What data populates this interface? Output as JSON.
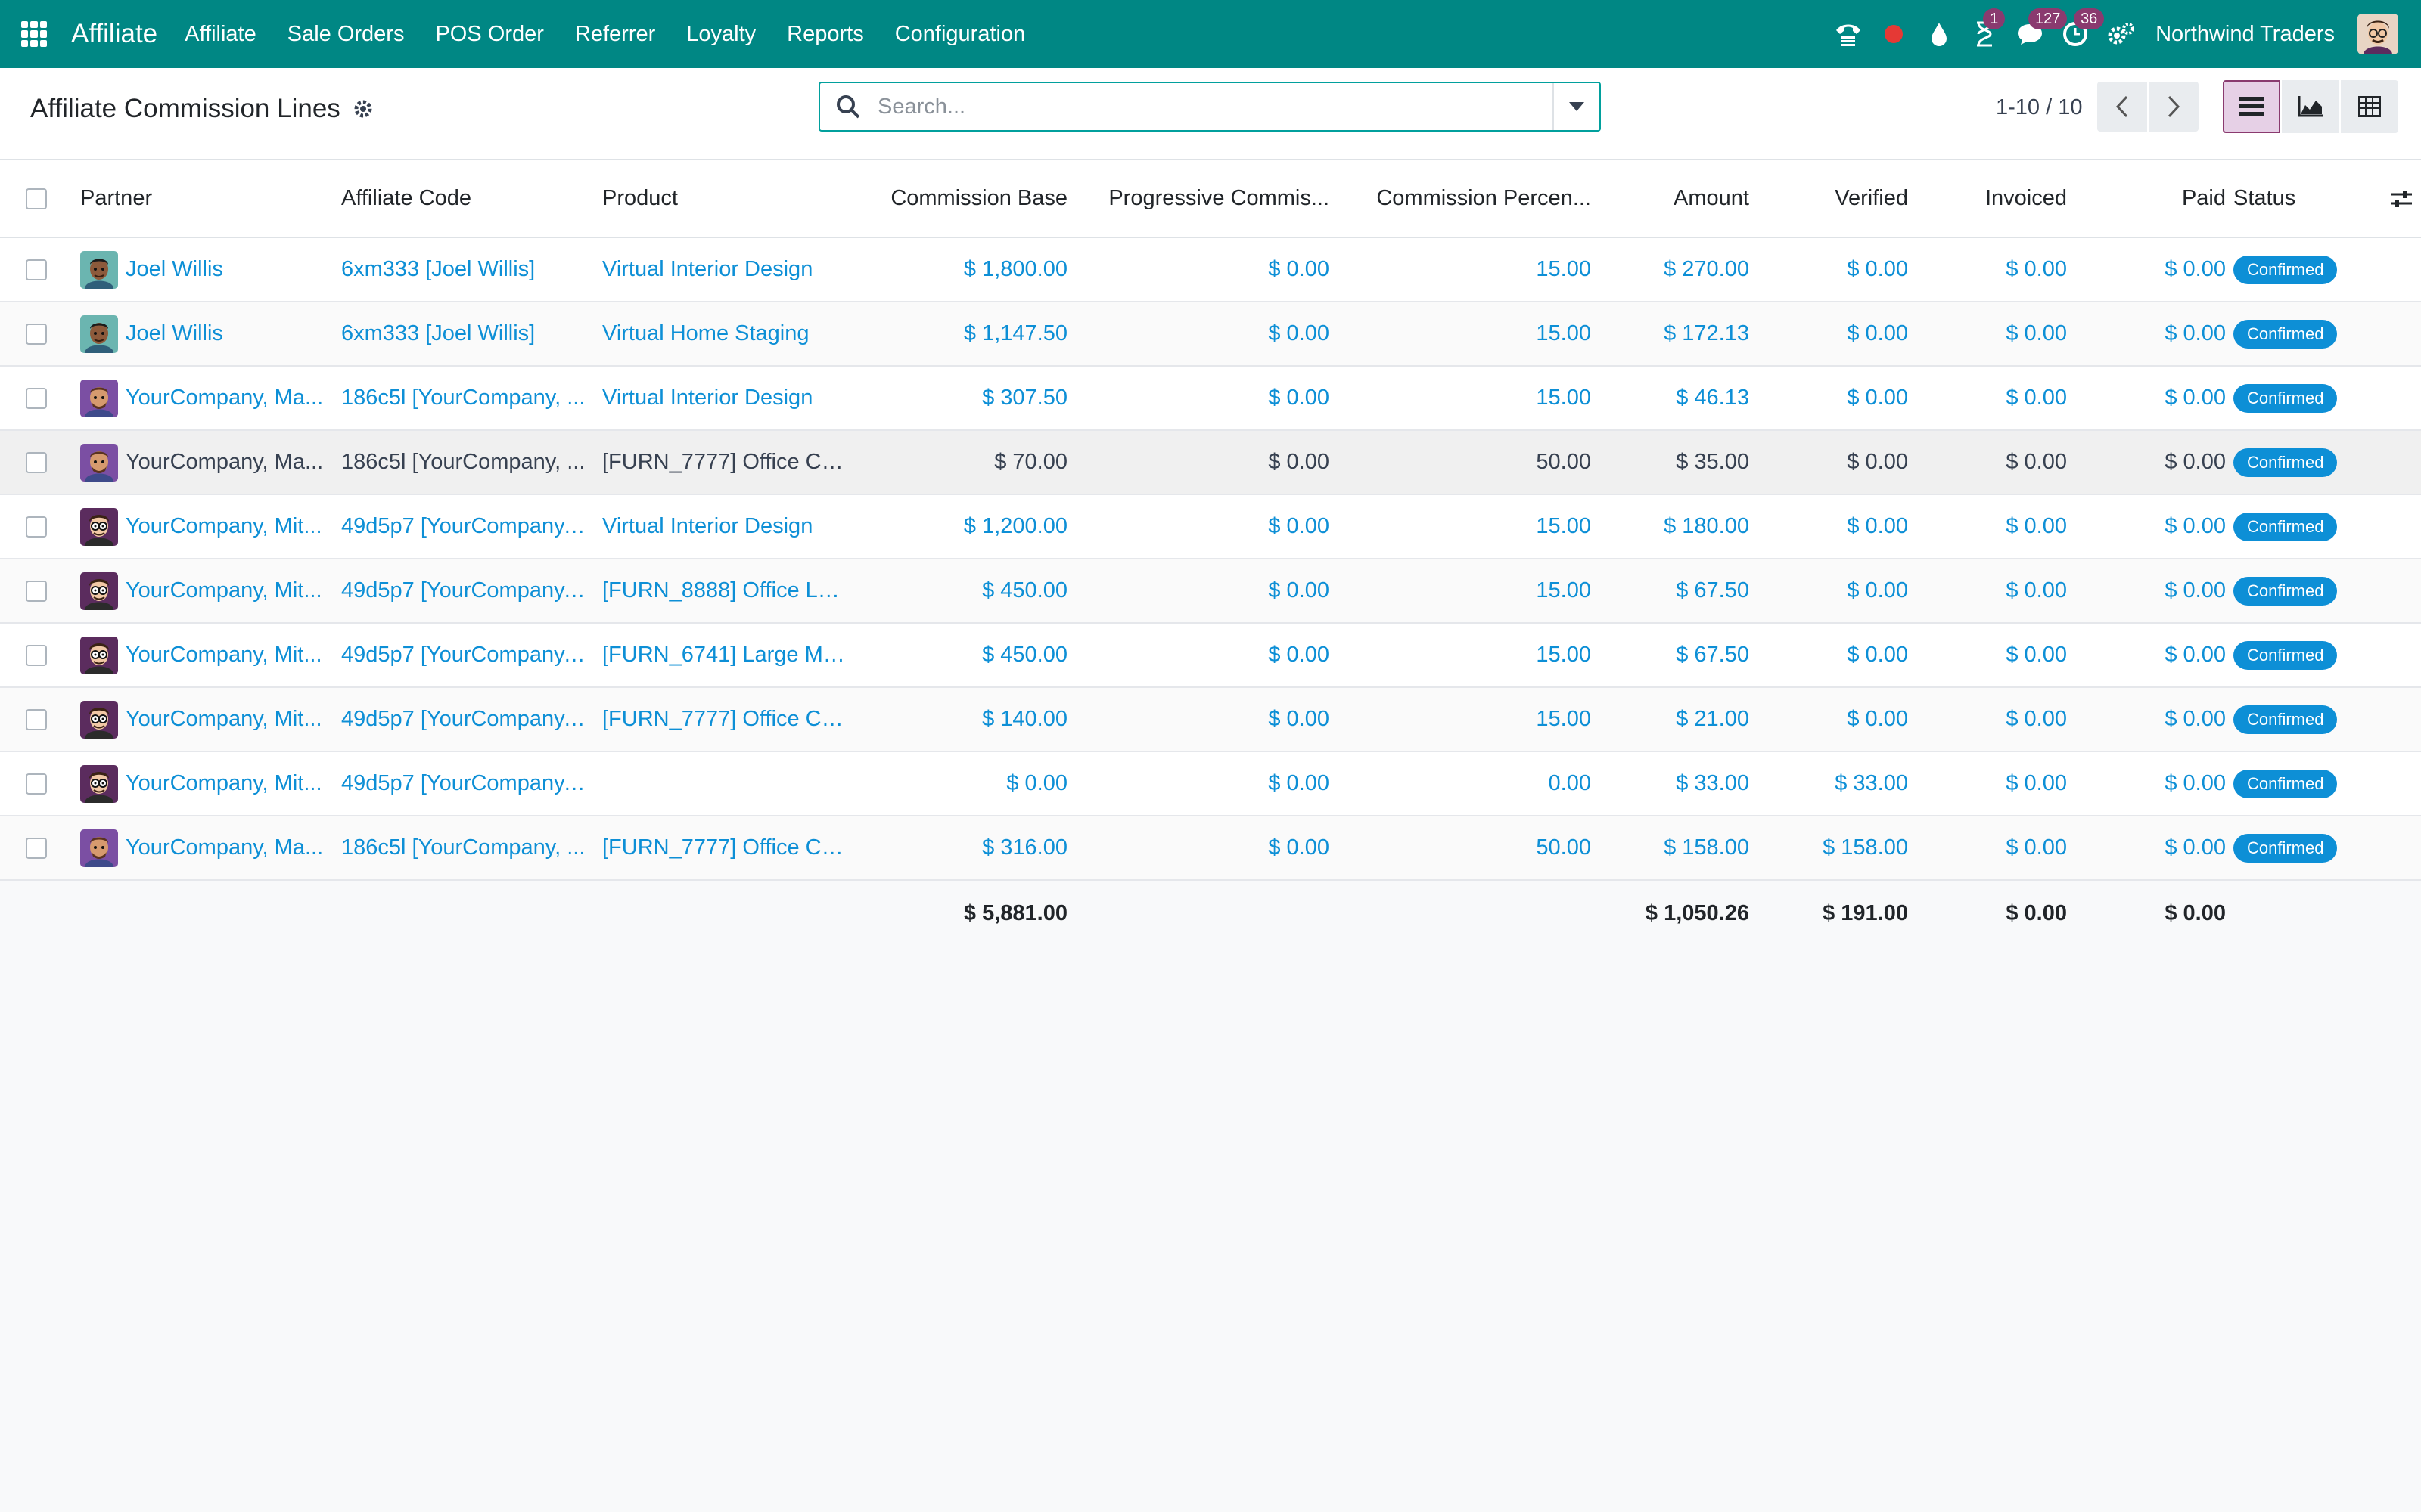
{
  "navbar": {
    "app_title": "Affiliate",
    "menu": [
      "Affiliate",
      "Sale Orders",
      "POS Order",
      "Referrer",
      "Loyalty",
      "Reports",
      "Configuration"
    ],
    "badges": {
      "activities": "1",
      "messages": "127",
      "clock": "36"
    },
    "company": "Northwind Traders",
    "color": "#008784",
    "icons": [
      "apps-icon",
      "phone-icon",
      "record-icon",
      "drop-icon",
      "hourglass-icon",
      "chat-icon",
      "clock-icon",
      "settings-icon"
    ]
  },
  "control_panel": {
    "title": "Affiliate Commission Lines",
    "search_placeholder": "Search...",
    "pager": "1-10 / 10"
  },
  "table": {
    "columns": {
      "partner": "Partner",
      "affiliate_code": "Affiliate Code",
      "product": "Product",
      "commission_base": "Commission Base",
      "progressive": "Progressive Commis...",
      "percent": "Commission Percen...",
      "amount": "Amount",
      "verified": "Verified",
      "invoiced": "Invoiced",
      "paid": "Paid",
      "status": "Status"
    },
    "rows": [
      {
        "partner": "Joel Willis",
        "avatar": "joel",
        "code": "6xm333 [Joel Willis]",
        "product": "Virtual Interior Design",
        "base": "$ 1,800.00",
        "progressive": "$ 0.00",
        "percent": "15.00",
        "amount": "$ 270.00",
        "verified": "$ 0.00",
        "invoiced": "$ 0.00",
        "paid": "$ 0.00",
        "status": "Confirmed"
      },
      {
        "partner": "Joel Willis",
        "avatar": "joel",
        "code": "6xm333 [Joel Willis]",
        "product": "Virtual Home Staging",
        "base": "$ 1,147.50",
        "progressive": "$ 0.00",
        "percent": "15.00",
        "amount": "$ 172.13",
        "verified": "$ 0.00",
        "invoiced": "$ 0.00",
        "paid": "$ 0.00",
        "status": "Confirmed"
      },
      {
        "partner": "YourCompany, Ma...",
        "avatar": "marc",
        "code": "186c5l [YourCompany, ...",
        "product": "Virtual Interior Design",
        "base": "$ 307.50",
        "progressive": "$ 0.00",
        "percent": "15.00",
        "amount": "$ 46.13",
        "verified": "$ 0.00",
        "invoiced": "$ 0.00",
        "paid": "$ 0.00",
        "status": "Confirmed"
      },
      {
        "partner": "YourCompany, Ma...",
        "avatar": "marc",
        "code": "186c5l [YourCompany, ...",
        "product": "[FURN_7777] Office Ch...",
        "base": "$ 70.00",
        "progressive": "$ 0.00",
        "percent": "50.00",
        "amount": "$ 35.00",
        "verified": "$ 0.00",
        "invoiced": "$ 0.00",
        "paid": "$ 0.00",
        "status": "Confirmed",
        "muted": true
      },
      {
        "partner": "YourCompany, Mit...",
        "avatar": "mitchell",
        "code": "49d5p7 [YourCompany,...",
        "product": "Virtual Interior Design",
        "base": "$ 1,200.00",
        "progressive": "$ 0.00",
        "percent": "15.00",
        "amount": "$ 180.00",
        "verified": "$ 0.00",
        "invoiced": "$ 0.00",
        "paid": "$ 0.00",
        "status": "Confirmed"
      },
      {
        "partner": "YourCompany, Mit...",
        "avatar": "mitchell",
        "code": "49d5p7 [YourCompany,...",
        "product": "[FURN_8888] Office La...",
        "base": "$ 450.00",
        "progressive": "$ 0.00",
        "percent": "15.00",
        "amount": "$ 67.50",
        "verified": "$ 0.00",
        "invoiced": "$ 0.00",
        "paid": "$ 0.00",
        "status": "Confirmed"
      },
      {
        "partner": "YourCompany, Mit...",
        "avatar": "mitchell",
        "code": "49d5p7 [YourCompany,...",
        "product": "[FURN_6741] Large Me...",
        "base": "$ 450.00",
        "progressive": "$ 0.00",
        "percent": "15.00",
        "amount": "$ 67.50",
        "verified": "$ 0.00",
        "invoiced": "$ 0.00",
        "paid": "$ 0.00",
        "status": "Confirmed"
      },
      {
        "partner": "YourCompany, Mit...",
        "avatar": "mitchell",
        "code": "49d5p7 [YourCompany,...",
        "product": "[FURN_7777] Office Ch...",
        "base": "$ 140.00",
        "progressive": "$ 0.00",
        "percent": "15.00",
        "amount": "$ 21.00",
        "verified": "$ 0.00",
        "invoiced": "$ 0.00",
        "paid": "$ 0.00",
        "status": "Confirmed"
      },
      {
        "partner": "YourCompany, Mit...",
        "avatar": "mitchell",
        "code": "49d5p7 [YourCompany,...",
        "product": "",
        "base": "$ 0.00",
        "progressive": "$ 0.00",
        "percent": "0.00",
        "amount": "$ 33.00",
        "verified": "$ 33.00",
        "invoiced": "$ 0.00",
        "paid": "$ 0.00",
        "status": "Confirmed"
      },
      {
        "partner": "YourCompany, Ma...",
        "avatar": "marc",
        "code": "186c5l [YourCompany, ...",
        "product": "[FURN_7777] Office Ch...",
        "base": "$ 316.00",
        "progressive": "$ 0.00",
        "percent": "50.00",
        "amount": "$ 158.00",
        "verified": "$ 158.00",
        "invoiced": "$ 0.00",
        "paid": "$ 0.00",
        "status": "Confirmed"
      }
    ],
    "totals": {
      "base": "$ 5,881.00",
      "amount": "$ 1,050.26",
      "verified": "$ 191.00",
      "invoiced": "$ 0.00",
      "paid": "$ 0.00"
    }
  },
  "colors": {
    "link": "#0d8fd6",
    "badge": "#0d8fd6",
    "accent": "#8a3a6f"
  }
}
